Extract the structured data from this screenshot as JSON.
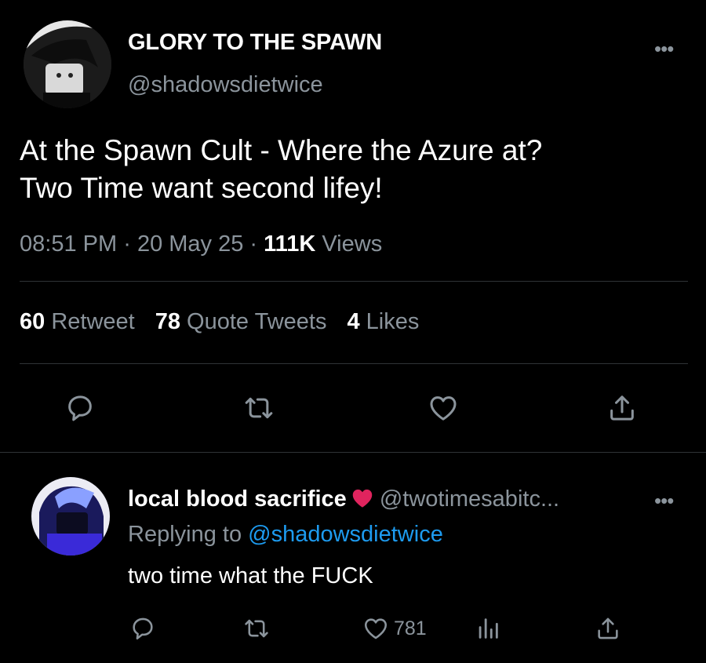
{
  "tweet": {
    "display_name": "GLORY TO THE SPAWN",
    "handle": "@shadowsdietwice",
    "more_icon": "more-horizontal-icon",
    "text_line1": "At the Spawn Cult - Where the Azure at?",
    "text_line2": "Two Time want second lifey!",
    "time": "08:51 PM",
    "date": "20 May 25",
    "separator": "·",
    "views_count": "111K",
    "views_label": "Views",
    "stats": {
      "retweets_count": "60",
      "retweets_label": "Retweet",
      "quotes_count": "78",
      "quotes_label": "Quote Tweets",
      "likes_count": "4",
      "likes_label": "Likes"
    },
    "actions": [
      "reply-icon",
      "retweet-icon",
      "like-icon",
      "share-icon"
    ]
  },
  "reply": {
    "display_name": "local blood sacrifice",
    "handle": "@twotimesabitc...",
    "replying_prefix": "Replying to",
    "replying_handle": "@shadowsdietwice",
    "text": "two time what the FUCK",
    "like_count": "781",
    "actions": [
      "reply-icon",
      "retweet-icon",
      "like-icon",
      "analytics-icon",
      "share-icon"
    ]
  },
  "colors": {
    "background": "#000000",
    "text_primary": "#ffffff",
    "text_secondary": "#8b949c",
    "link": "#1d9bf0",
    "divider": "#2f3336",
    "heart_emoji": "#e0245e"
  }
}
